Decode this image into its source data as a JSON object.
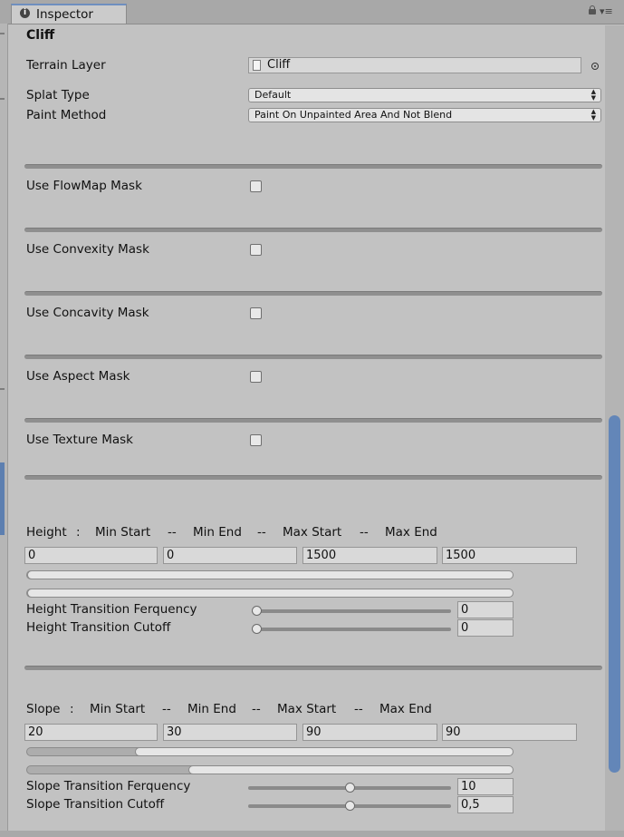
{
  "window": {
    "tab_title": "Inspector",
    "tab_icon": "info-icon",
    "header_icons": [
      "lock-icon",
      "menu-icon"
    ]
  },
  "section": {
    "title": "Cliff"
  },
  "terrain_layer": {
    "label": "Terrain Layer",
    "value": "Cliff",
    "icons": [
      "file-icon",
      "object-picker-icon"
    ]
  },
  "splat_type": {
    "label": "Splat Type",
    "value": "Default"
  },
  "paint_method": {
    "label": "Paint Method",
    "value": "Paint On Unpainted Area And Not Blend"
  },
  "masks": [
    {
      "label": "Use FlowMap Mask",
      "checked": false
    },
    {
      "label": "Use Convexity Mask",
      "checked": false
    },
    {
      "label": "Use Concavity Mask",
      "checked": false
    },
    {
      "label": "Use Aspect Mask",
      "checked": false
    },
    {
      "label": "Use Texture Mask",
      "checked": false
    }
  ],
  "height": {
    "label": "Height",
    "colon": ":",
    "sep": "--",
    "headers": [
      "Min Start",
      "Min End",
      "Max Start",
      "Max End"
    ],
    "values": [
      "0",
      "0",
      "1500",
      "1500"
    ],
    "range_min": 0,
    "range_max": 1500,
    "transition_frequency": {
      "label": "Height Transition Ferquency",
      "value": "0",
      "level": 0
    },
    "transition_cutoff": {
      "label": "Height Transition Cutoff",
      "value": "0",
      "level": 0
    }
  },
  "slope": {
    "label": "Slope",
    "colon": ":",
    "sep": "--",
    "headers": [
      "Min Start",
      "Min End",
      "Max Start",
      "Max End"
    ],
    "values": [
      "20",
      "30",
      "90",
      "90"
    ],
    "range_min": 0,
    "range_max": 90,
    "transition_frequency": {
      "label": "Slope Transition Ferquency",
      "value": "10",
      "level": 0.5
    },
    "transition_cutoff": {
      "label": "Slope Transition Cutoff",
      "value": "0,5",
      "level": 0.5
    }
  },
  "colors": {
    "accent": "#6386b8",
    "panel": "#c2c2c2",
    "field": "#d9d9d9"
  }
}
